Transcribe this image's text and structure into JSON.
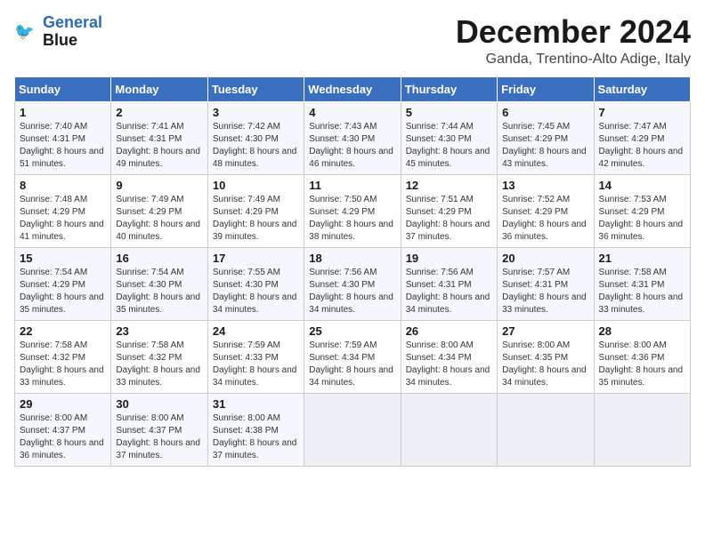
{
  "header": {
    "logo_line1": "General",
    "logo_line2": "Blue",
    "title": "December 2024",
    "location": "Ganda, Trentino-Alto Adige, Italy"
  },
  "weekdays": [
    "Sunday",
    "Monday",
    "Tuesday",
    "Wednesday",
    "Thursday",
    "Friday",
    "Saturday"
  ],
  "weeks": [
    [
      {
        "day": "1",
        "sunrise": "7:40 AM",
        "sunset": "4:31 PM",
        "daylight": "8 hours and 51 minutes."
      },
      {
        "day": "2",
        "sunrise": "7:41 AM",
        "sunset": "4:31 PM",
        "daylight": "8 hours and 49 minutes."
      },
      {
        "day": "3",
        "sunrise": "7:42 AM",
        "sunset": "4:30 PM",
        "daylight": "8 hours and 48 minutes."
      },
      {
        "day": "4",
        "sunrise": "7:43 AM",
        "sunset": "4:30 PM",
        "daylight": "8 hours and 46 minutes."
      },
      {
        "day": "5",
        "sunrise": "7:44 AM",
        "sunset": "4:30 PM",
        "daylight": "8 hours and 45 minutes."
      },
      {
        "day": "6",
        "sunrise": "7:45 AM",
        "sunset": "4:29 PM",
        "daylight": "8 hours and 43 minutes."
      },
      {
        "day": "7",
        "sunrise": "7:47 AM",
        "sunset": "4:29 PM",
        "daylight": "8 hours and 42 minutes."
      }
    ],
    [
      {
        "day": "8",
        "sunrise": "7:48 AM",
        "sunset": "4:29 PM",
        "daylight": "8 hours and 41 minutes."
      },
      {
        "day": "9",
        "sunrise": "7:49 AM",
        "sunset": "4:29 PM",
        "daylight": "8 hours and 40 minutes."
      },
      {
        "day": "10",
        "sunrise": "7:49 AM",
        "sunset": "4:29 PM",
        "daylight": "8 hours and 39 minutes."
      },
      {
        "day": "11",
        "sunrise": "7:50 AM",
        "sunset": "4:29 PM",
        "daylight": "8 hours and 38 minutes."
      },
      {
        "day": "12",
        "sunrise": "7:51 AM",
        "sunset": "4:29 PM",
        "daylight": "8 hours and 37 minutes."
      },
      {
        "day": "13",
        "sunrise": "7:52 AM",
        "sunset": "4:29 PM",
        "daylight": "8 hours and 36 minutes."
      },
      {
        "day": "14",
        "sunrise": "7:53 AM",
        "sunset": "4:29 PM",
        "daylight": "8 hours and 36 minutes."
      }
    ],
    [
      {
        "day": "15",
        "sunrise": "7:54 AM",
        "sunset": "4:29 PM",
        "daylight": "8 hours and 35 minutes."
      },
      {
        "day": "16",
        "sunrise": "7:54 AM",
        "sunset": "4:30 PM",
        "daylight": "8 hours and 35 minutes."
      },
      {
        "day": "17",
        "sunrise": "7:55 AM",
        "sunset": "4:30 PM",
        "daylight": "8 hours and 34 minutes."
      },
      {
        "day": "18",
        "sunrise": "7:56 AM",
        "sunset": "4:30 PM",
        "daylight": "8 hours and 34 minutes."
      },
      {
        "day": "19",
        "sunrise": "7:56 AM",
        "sunset": "4:31 PM",
        "daylight": "8 hours and 34 minutes."
      },
      {
        "day": "20",
        "sunrise": "7:57 AM",
        "sunset": "4:31 PM",
        "daylight": "8 hours and 33 minutes."
      },
      {
        "day": "21",
        "sunrise": "7:58 AM",
        "sunset": "4:31 PM",
        "daylight": "8 hours and 33 minutes."
      }
    ],
    [
      {
        "day": "22",
        "sunrise": "7:58 AM",
        "sunset": "4:32 PM",
        "daylight": "8 hours and 33 minutes."
      },
      {
        "day": "23",
        "sunrise": "7:58 AM",
        "sunset": "4:32 PM",
        "daylight": "8 hours and 33 minutes."
      },
      {
        "day": "24",
        "sunrise": "7:59 AM",
        "sunset": "4:33 PM",
        "daylight": "8 hours and 34 minutes."
      },
      {
        "day": "25",
        "sunrise": "7:59 AM",
        "sunset": "4:34 PM",
        "daylight": "8 hours and 34 minutes."
      },
      {
        "day": "26",
        "sunrise": "8:00 AM",
        "sunset": "4:34 PM",
        "daylight": "8 hours and 34 minutes."
      },
      {
        "day": "27",
        "sunrise": "8:00 AM",
        "sunset": "4:35 PM",
        "daylight": "8 hours and 34 minutes."
      },
      {
        "day": "28",
        "sunrise": "8:00 AM",
        "sunset": "4:36 PM",
        "daylight": "8 hours and 35 minutes."
      }
    ],
    [
      {
        "day": "29",
        "sunrise": "8:00 AM",
        "sunset": "4:37 PM",
        "daylight": "8 hours and 36 minutes."
      },
      {
        "day": "30",
        "sunrise": "8:00 AM",
        "sunset": "4:37 PM",
        "daylight": "8 hours and 37 minutes."
      },
      {
        "day": "31",
        "sunrise": "8:00 AM",
        "sunset": "4:38 PM",
        "daylight": "8 hours and 37 minutes."
      },
      null,
      null,
      null,
      null
    ]
  ],
  "labels": {
    "sunrise": "Sunrise: ",
    "sunset": "Sunset: ",
    "daylight": "Daylight: "
  }
}
